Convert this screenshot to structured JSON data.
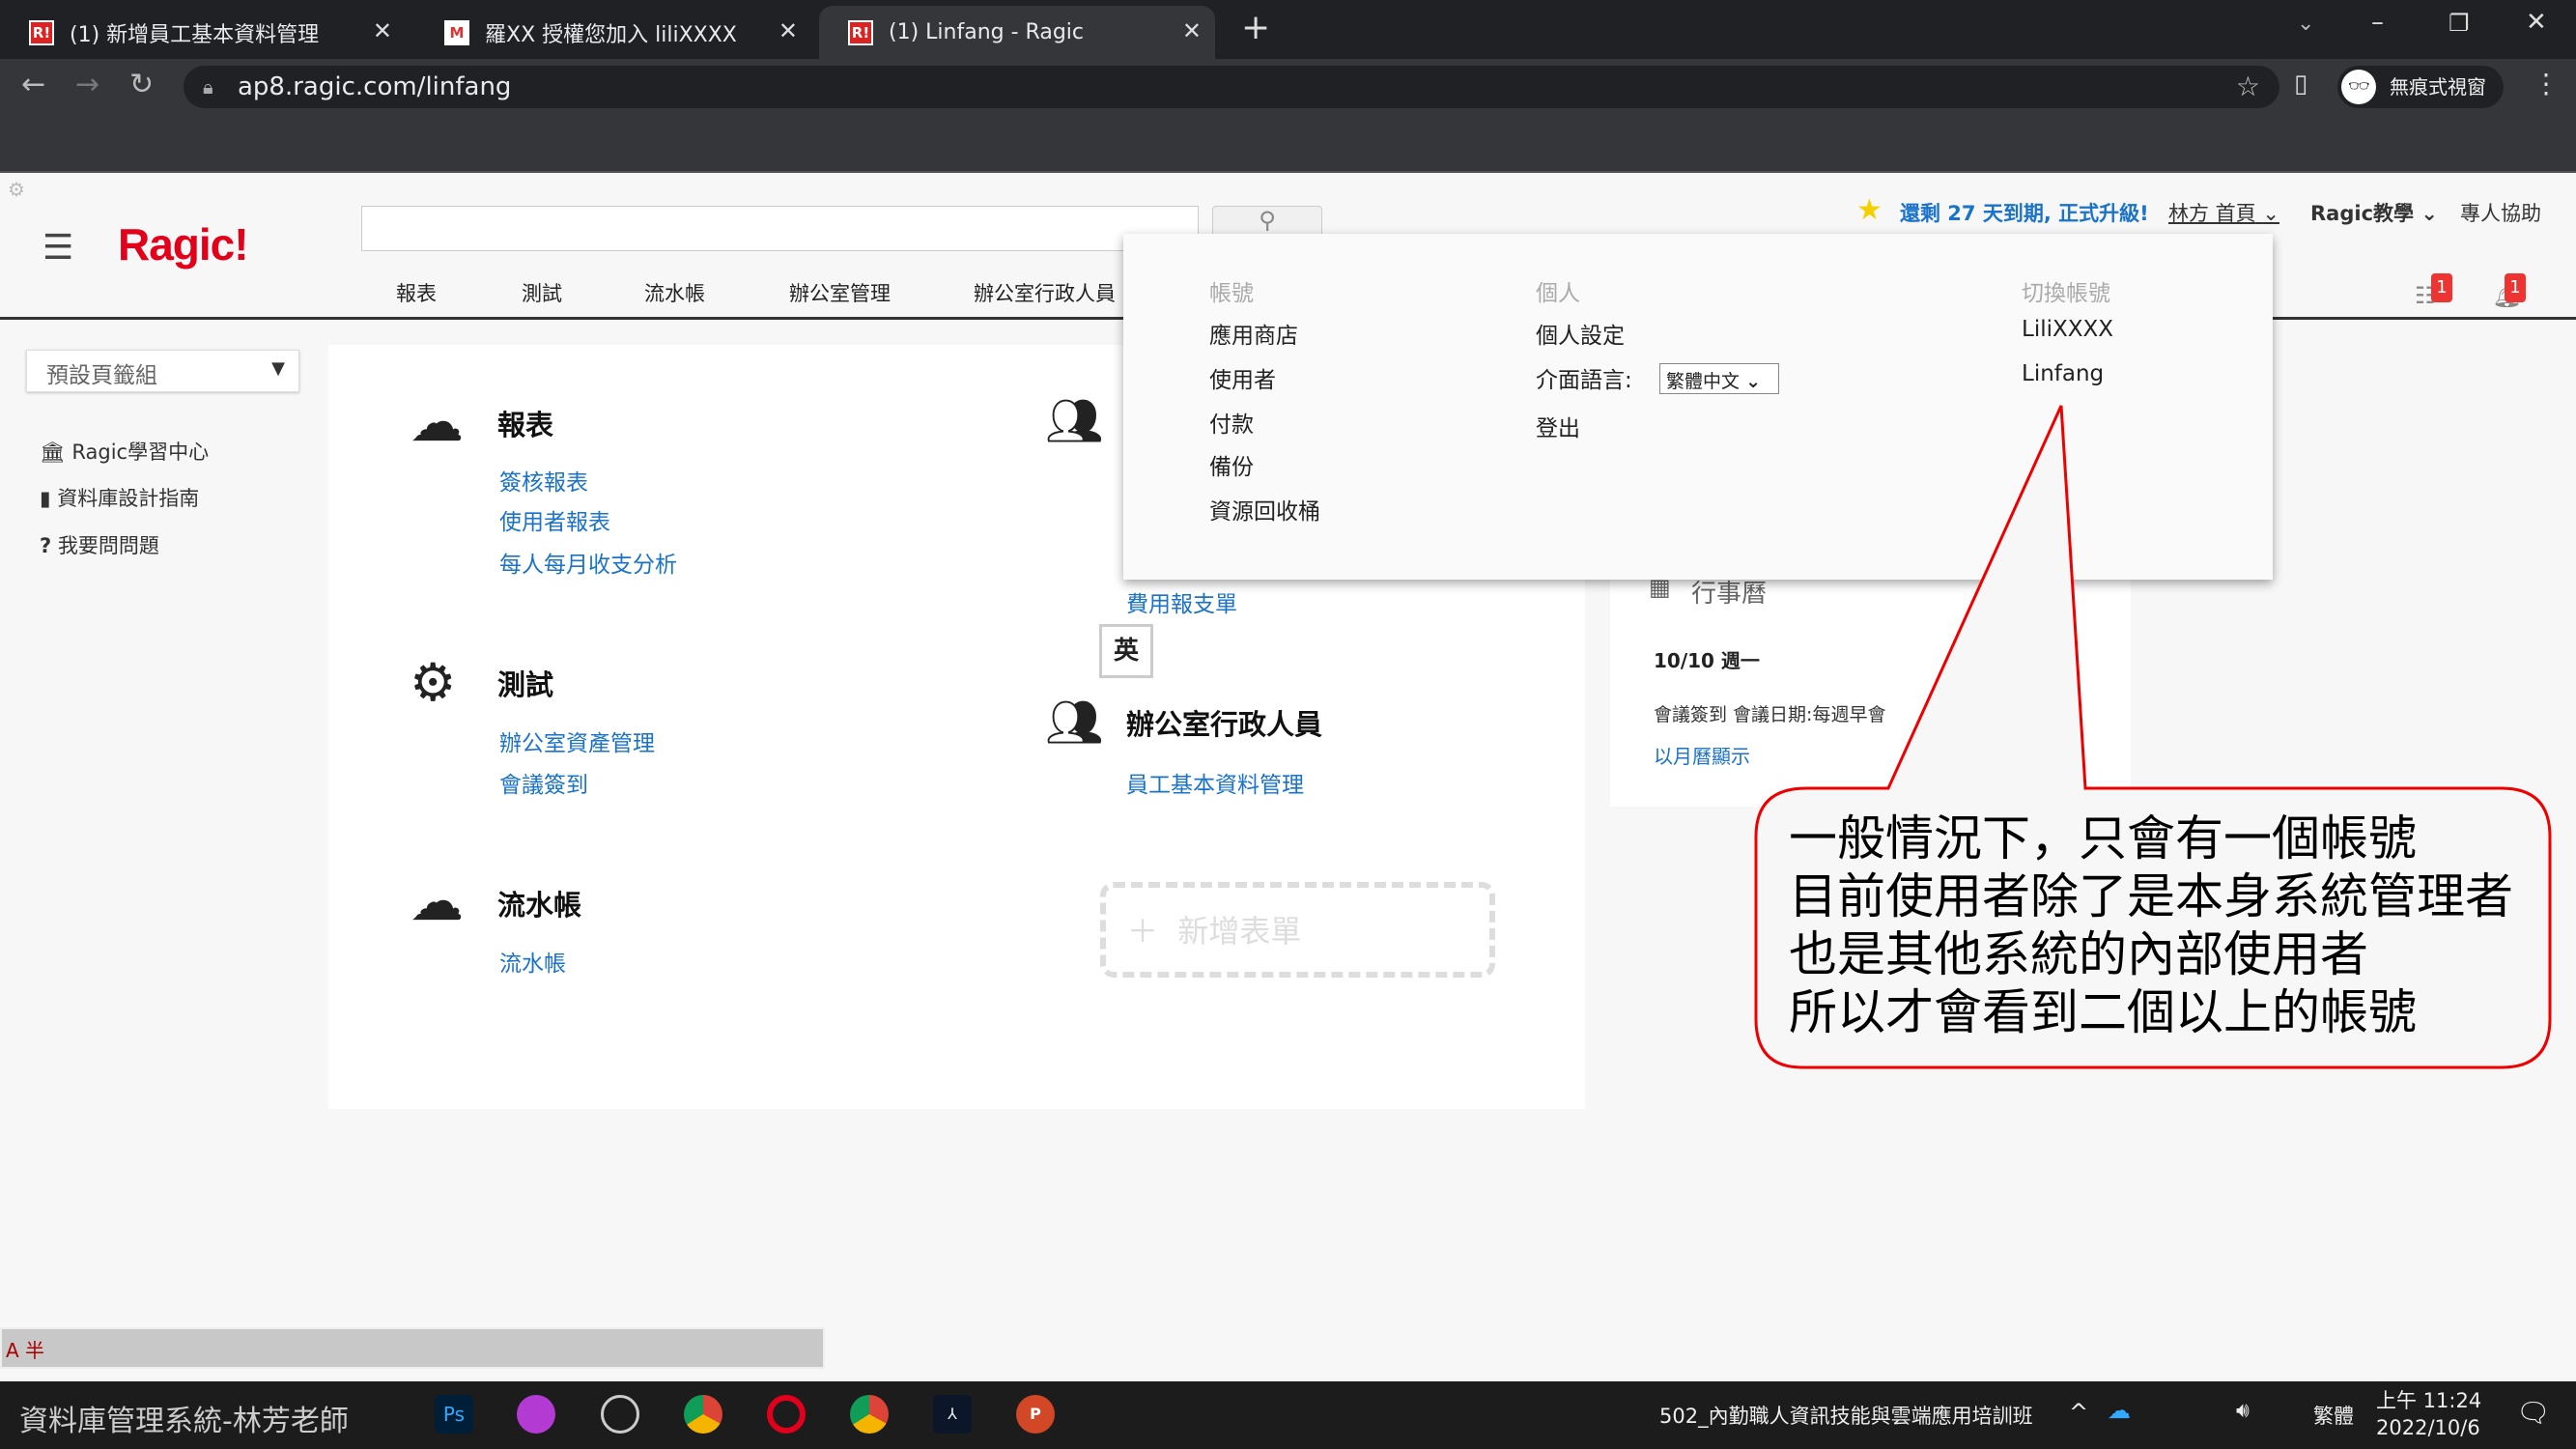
{
  "browser": {
    "tabs": [
      {
        "label": "(1) 新增員工基本資料管理",
        "favicon": "R!"
      },
      {
        "label": "羅XX  授權您加入 liliXXXX",
        "favicon": "M"
      },
      {
        "label": "(1) Linfang - Ragic",
        "favicon": "R!",
        "active": true
      }
    ],
    "url": "ap8.ragic.com/linfang",
    "profile_label": "無痕式視窗"
  },
  "app": {
    "logo": "Ragic!",
    "search_placeholder": "",
    "nav_tabs": [
      "報表",
      "測試",
      "流水帳",
      "辦公室管理",
      "辦公室行政人員"
    ],
    "trial_notice": "還剩 27 天到期, 正式升級!",
    "user_menu": "林方 首頁",
    "tutorial_menu": "Ragic教學",
    "support": "專人協助",
    "badges": [
      "1",
      "1"
    ],
    "accent_color": "#e3001b",
    "link_color": "#1a73c8"
  },
  "dropdown": {
    "account": {
      "header": "帳號",
      "items": [
        "應用商店",
        "使用者",
        "付款",
        "備份",
        "資源回收桶"
      ]
    },
    "personal": {
      "header": "個人",
      "settings": "個人設定",
      "language_label": "介面語言:",
      "language_value": "繁體中文",
      "logout": "登出"
    },
    "switch": {
      "header": "切換帳號",
      "items": [
        "LiliXXXX",
        "Linfang"
      ]
    }
  },
  "sidebar": {
    "tab_group": "預設頁籤組",
    "items": [
      {
        "label": "Ragic學習中心",
        "icon": "bank-icon"
      },
      {
        "label": "資料庫設計指南",
        "icon": "book-icon"
      },
      {
        "label": "我要問問題",
        "icon": "question-icon"
      }
    ]
  },
  "sections": [
    {
      "title": "報表",
      "icon": "cloud-icon",
      "links": [
        "簽核報表",
        "使用者報表",
        "每人每月收支分析"
      ]
    },
    {
      "title": "測試",
      "icon": "gear-icon",
      "links": [
        "辦公室資產管理",
        "會議簽到"
      ]
    },
    {
      "title": "流水帳",
      "icon": "cloud-icon",
      "links": [
        "流水帳"
      ]
    },
    {
      "title": "",
      "icon": "people-icon",
      "links": [
        "費用報支單"
      ]
    },
    {
      "title": "辦公室行政人員",
      "icon": "people-icon",
      "links": [
        "員工基本資料管理"
      ]
    }
  ],
  "ime_indicator": "英",
  "add_form": "新增表單",
  "calendar": {
    "title": "行事曆",
    "date": "10/10 週一",
    "event": "會議簽到 會議日期:每週早會",
    "month_view": "以月曆顯示"
  },
  "callout": {
    "lines": [
      "一般情況下，只會有一個帳號",
      "目前使用者除了是本身系統管理者",
      "也是其他系統的內部使用者",
      "所以才會看到二個以上的帳號"
    ]
  },
  "taskbar": {
    "caption": "資料庫管理系統-林芳老師",
    "window_title": "502_內勤職人資訊技能與雲端應用培訓班",
    "ime": "繁體",
    "time": "上午 11:24",
    "date": "2022/10/6",
    "ime_bar": "A 半"
  }
}
